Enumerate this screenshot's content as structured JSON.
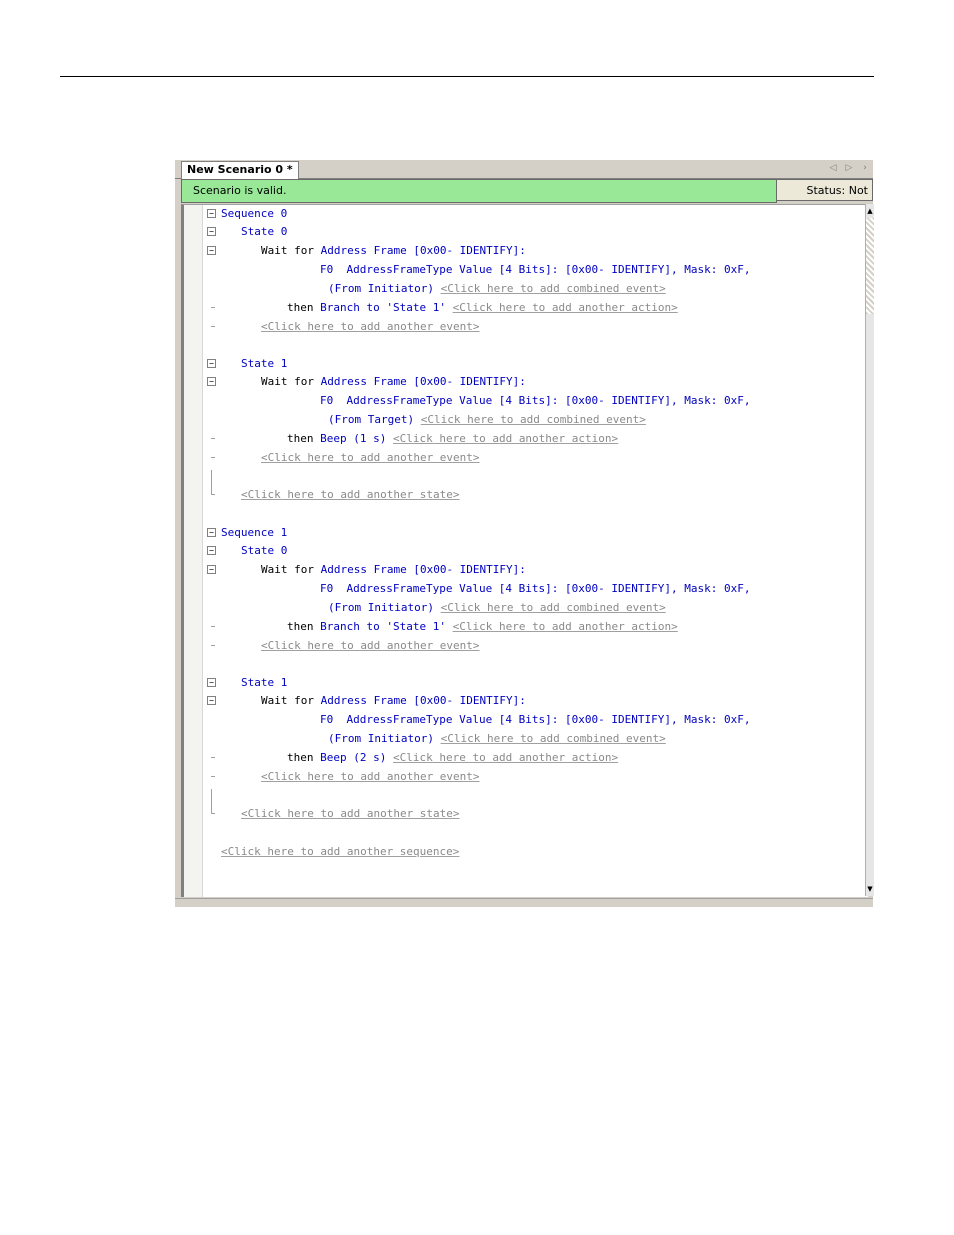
{
  "window": {
    "tab_title": "New Scenario 0 *",
    "nav_prev": "◁",
    "nav_next": "▷",
    "nav_more": "›"
  },
  "status": {
    "valid_text": "Scenario is valid.",
    "saved_text": "Status: Not saved"
  },
  "editor": {
    "seq0_label": "Sequence 0",
    "s0_0_label": "State 0",
    "s0_0_wait": "Address Frame [0x00- IDENTIFY]:",
    "s0_0_cond_a": "F0  AddressFrameType Value [4 Bits]: [0x00- IDENTIFY], Mask: 0xF,",
    "s0_0_cond_b": "(From Initiator)",
    "s0_0_combined": "<Click here to add combined event>",
    "s0_0_action": "Branch to 'State 1'",
    "s0_0_add_action": "<Click here to add another action>",
    "s0_0_add_event": "<Click here to add another event>",
    "s0_1_label": "State 1",
    "s0_1_wait": "Address Frame [0x00- IDENTIFY]:",
    "s0_1_cond_a": "F0  AddressFrameType Value [4 Bits]: [0x00- IDENTIFY], Mask: 0xF,",
    "s0_1_cond_b": "(From Target)",
    "s0_1_combined": "<Click here to add combined event>",
    "s0_1_action": "Beep (1 s)",
    "s0_1_add_action": "<Click here to add another action>",
    "s0_1_add_event": "<Click here to add another event>",
    "seq0_add_state": "<Click here to add another state>",
    "seq1_label": "Sequence 1",
    "s1_0_label": "State 0",
    "s1_0_wait": "Address Frame [0x00- IDENTIFY]:",
    "s1_0_cond_a": "F0  AddressFrameType Value [4 Bits]: [0x00- IDENTIFY], Mask: 0xF,",
    "s1_0_cond_b": "(From Initiator)",
    "s1_0_combined": "<Click here to add combined event>",
    "s1_0_action": "Branch to 'State 1'",
    "s1_0_add_action": "<Click here to add another action>",
    "s1_0_add_event": "<Click here to add another event>",
    "s1_1_label": "State 1",
    "s1_1_wait": "Address Frame [0x00- IDENTIFY]:",
    "s1_1_cond_a": "F0  AddressFrameType Value [4 Bits]: [0x00- IDENTIFY], Mask: 0xF,",
    "s1_1_cond_b": "(From Initiator)",
    "s1_1_combined": "<Click here to add combined event>",
    "s1_1_action": "Beep (2 s)",
    "s1_1_add_action": "<Click here to add another action>",
    "s1_1_add_event": "<Click here to add another event>",
    "seq1_add_state": "<Click here to add another state>",
    "add_sequence": "<Click here to add another sequence>",
    "kw_wait": "Wait for",
    "kw_then": "then"
  },
  "colors": {
    "status_valid_bg": "#98e898",
    "keyword_blue": "#0000c0",
    "link_gray": "#8a8a8a"
  }
}
